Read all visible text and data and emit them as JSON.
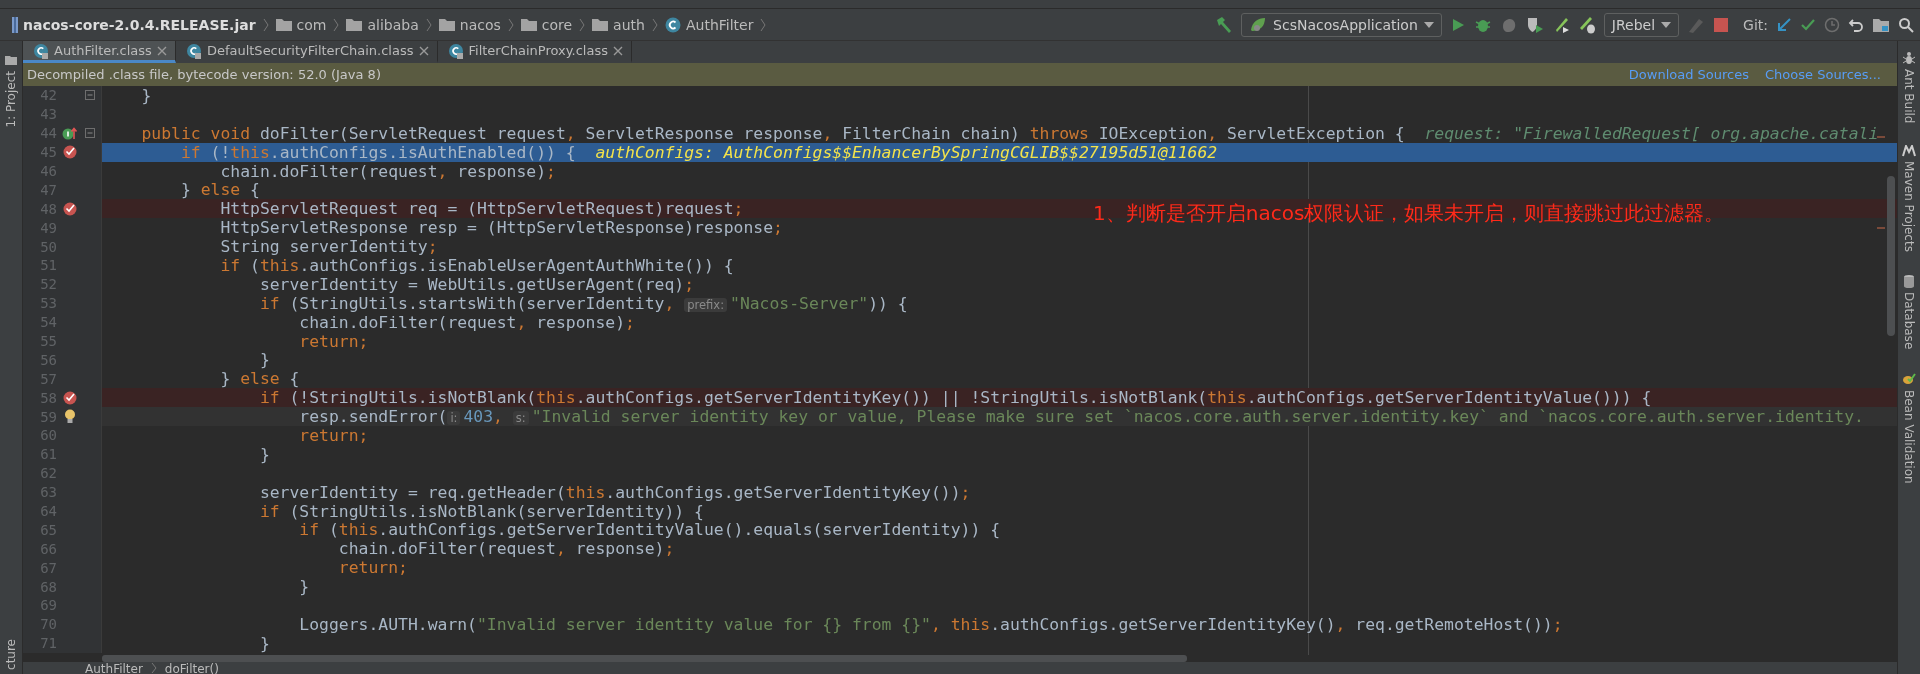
{
  "breadcrumbs": [
    {
      "kind": "jar",
      "label": "nacos-core-2.0.4.RELEASE.jar"
    },
    {
      "kind": "package",
      "label": "com"
    },
    {
      "kind": "package",
      "label": "alibaba"
    },
    {
      "kind": "package",
      "label": "nacos"
    },
    {
      "kind": "package",
      "label": "core"
    },
    {
      "kind": "package",
      "label": "auth"
    },
    {
      "kind": "class",
      "label": "AuthFilter"
    }
  ],
  "toolbar": {
    "run_config": "ScsNacosApplication",
    "jrebel": "JRebel",
    "git_label": "Git:"
  },
  "tabs": [
    {
      "label": "AuthFilter.class",
      "selected": true
    },
    {
      "label": "DefaultSecurityFilterChain.class",
      "selected": false
    },
    {
      "label": "FilterChainProxy.class",
      "selected": false
    }
  ],
  "left_tools": [
    {
      "label": "1: Project"
    }
  ],
  "left_tools_bottom": [
    {
      "label": "cture"
    }
  ],
  "right_tools": [
    {
      "kind": "ant",
      "label": "Ant Build"
    },
    {
      "kind": "maven",
      "label": "Maven Projects"
    },
    {
      "kind": "database",
      "label": "Database"
    },
    {
      "kind": "bean",
      "label": "Bean Validation"
    }
  ],
  "banner": {
    "text": "Decompiled .class file, bytecode version: 52.0 (Java 8)",
    "links": [
      "Download Sources",
      "Choose Sources..."
    ]
  },
  "annotation": "1、判断是否开启nacos权限认证，如果未开启，则直接跳过此过滤器。",
  "lines": [
    {
      "number": "42",
      "kind": "plain",
      "fold": true,
      "tokens": [
        {
          "kind": "plain",
          "t": "    }"
        }
      ]
    },
    {
      "number": "43",
      "kind": "plain",
      "fold": false
    },
    {
      "number": "44",
      "kind": "plain",
      "gutter_icon": {
        "kind": "override"
      },
      "fold": true,
      "tokens": [
        {
          "kind": "kw",
          "t": "    public void"
        },
        {
          "kind": "plain",
          "t": " doFilter(ServletRequest request"
        },
        {
          "kind": "kw",
          "t": ","
        },
        {
          "kind": "plain",
          "t": " ServletResponse response"
        },
        {
          "kind": "kw",
          "t": ","
        },
        {
          "kind": "plain",
          "t": " FilterChain chain) "
        },
        {
          "kind": "kw",
          "t": "throws"
        },
        {
          "kind": "plain",
          "t": " IOException"
        },
        {
          "kind": "kw",
          "t": ","
        },
        {
          "kind": "plain",
          "t": " ServletException {  "
        },
        {
          "kind": "debug",
          "t": "request: \"FirewalledRequest[ org.apache.catali"
        }
      ]
    },
    {
      "number": "45",
      "kind": "current",
      "gutter_icon": {
        "kind": "breakpoint"
      },
      "fold": false,
      "tokens": [
        {
          "kind": "kw",
          "t": "        if"
        },
        {
          "kind": "plain",
          "t": " (!"
        },
        {
          "kind": "kw",
          "t": "this"
        },
        {
          "kind": "plain",
          "t": ".authConfigs.isAuthEnabled()) {  "
        },
        {
          "kind": "debug",
          "t": "authConfigs: AuthConfigs$$EnhancerBySpringCGLIB$$27195d51@11662"
        }
      ]
    },
    {
      "number": "46",
      "kind": "plain",
      "fold": false,
      "tokens": [
        {
          "kind": "plain",
          "t": "            chain.doFilter(request"
        },
        {
          "kind": "kw",
          "t": ","
        },
        {
          "kind": "plain",
          "t": " response)"
        },
        {
          "kind": "kw",
          "t": ";"
        }
      ]
    },
    {
      "number": "47",
      "kind": "plain",
      "fold": false,
      "tokens": [
        {
          "kind": "plain",
          "t": "        } "
        },
        {
          "kind": "kw",
          "t": "else"
        },
        {
          "kind": "plain",
          "t": " {"
        }
      ]
    },
    {
      "number": "48",
      "kind": "breakpoint",
      "gutter_icon": {
        "kind": "breakpoint"
      },
      "fold": false,
      "tokens": [
        {
          "kind": "plain",
          "t": "            HttpServletRequest req = (HttpServletRequest)request"
        },
        {
          "kind": "kw",
          "t": ";"
        }
      ]
    },
    {
      "number": "49",
      "kind": "plain",
      "fold": false,
      "tokens": [
        {
          "kind": "plain",
          "t": "            HttpServletResponse resp = (HttpServletResponse)response"
        },
        {
          "kind": "kw",
          "t": ";"
        }
      ]
    },
    {
      "number": "50",
      "kind": "plain",
      "fold": false,
      "tokens": [
        {
          "kind": "plain",
          "t": "            String serverIdentity"
        },
        {
          "kind": "kw",
          "t": ";"
        }
      ]
    },
    {
      "number": "51",
      "kind": "plain",
      "fold": false,
      "tokens": [
        {
          "kind": "kw",
          "t": "            if"
        },
        {
          "kind": "plain",
          "t": " ("
        },
        {
          "kind": "kw",
          "t": "this"
        },
        {
          "kind": "plain",
          "t": ".authConfigs.isEnableUserAgentAuthWhite()) {"
        }
      ]
    },
    {
      "number": "52",
      "kind": "plain",
      "fold": false,
      "tokens": [
        {
          "kind": "plain",
          "t": "                serverIdentity = WebUtils.getUserAgent(req)"
        },
        {
          "kind": "kw",
          "t": ";"
        }
      ]
    },
    {
      "number": "53",
      "kind": "plain",
      "fold": false,
      "tokens": [
        {
          "kind": "kw",
          "t": "                if"
        },
        {
          "kind": "plain",
          "t": " (StringUtils.startsWith(serverIdentity"
        },
        {
          "kind": "kw",
          "t": ", "
        },
        {
          "kind": "hint",
          "t": "prefix:"
        },
        {
          "kind": "str",
          "t": "\"Nacos-Server\""
        },
        {
          "kind": "plain",
          "t": ")) {"
        }
      ]
    },
    {
      "number": "54",
      "kind": "plain",
      "fold": false,
      "tokens": [
        {
          "kind": "plain",
          "t": "                    chain.doFilter(request"
        },
        {
          "kind": "kw",
          "t": ","
        },
        {
          "kind": "plain",
          "t": " response)"
        },
        {
          "kind": "kw",
          "t": ";"
        }
      ]
    },
    {
      "number": "55",
      "kind": "plain",
      "fold": false,
      "tokens": [
        {
          "kind": "kw",
          "t": "                    return;"
        }
      ]
    },
    {
      "number": "56",
      "kind": "plain",
      "fold": false,
      "tokens": [
        {
          "kind": "plain",
          "t": "                }"
        }
      ]
    },
    {
      "number": "57",
      "kind": "plain",
      "fold": false,
      "tokens": [
        {
          "kind": "plain",
          "t": "            } "
        },
        {
          "kind": "kw",
          "t": "else"
        },
        {
          "kind": "plain",
          "t": " {"
        }
      ]
    },
    {
      "number": "58",
      "kind": "breakpoint",
      "gutter_icon": {
        "kind": "breakpoint"
      },
      "fold": false,
      "tokens": [
        {
          "kind": "kw",
          "t": "                if"
        },
        {
          "kind": "plain",
          "t": " (!StringUtils.isNotBlank("
        },
        {
          "kind": "kw",
          "t": "this"
        },
        {
          "kind": "plain",
          "t": ".authConfigs.getServerIdentityKey()) || !StringUtils.isNotBlank("
        },
        {
          "kind": "kw",
          "t": "this"
        },
        {
          "kind": "plain",
          "t": ".authConfigs.getServerIdentityValue())) {"
        }
      ]
    },
    {
      "number": "59",
      "kind": "caret",
      "gutter_icon": {
        "kind": "bulb"
      },
      "fold": false,
      "tokens": [
        {
          "kind": "plain",
          "t": "                    resp.sendError("
        },
        {
          "kind": "hint",
          "t": "i:"
        },
        {
          "kind": "num",
          "t": "403"
        },
        {
          "kind": "kw",
          "t": ", "
        },
        {
          "kind": "hint",
          "t": "s:"
        },
        {
          "kind": "str",
          "t": "\"Invalid server identity key or value, Please make sure set `nacos.core.auth.server.identity.key` and `nacos.core.auth.server.identity."
        }
      ]
    },
    {
      "number": "60",
      "kind": "plain",
      "fold": false,
      "tokens": [
        {
          "kind": "kw",
          "t": "                    return;"
        }
      ]
    },
    {
      "number": "61",
      "kind": "plain",
      "fold": false,
      "tokens": [
        {
          "kind": "plain",
          "t": "                }"
        }
      ]
    },
    {
      "number": "62",
      "kind": "plain",
      "fold": false
    },
    {
      "number": "63",
      "kind": "plain",
      "fold": false,
      "tokens": [
        {
          "kind": "plain",
          "t": "                serverIdentity = req.getHeader("
        },
        {
          "kind": "kw",
          "t": "this"
        },
        {
          "kind": "plain",
          "t": ".authConfigs.getServerIdentityKey())"
        },
        {
          "kind": "kw",
          "t": ";"
        }
      ]
    },
    {
      "number": "64",
      "kind": "plain",
      "fold": false,
      "tokens": [
        {
          "kind": "kw",
          "t": "                if"
        },
        {
          "kind": "plain",
          "t": " (StringUtils.isNotBlank(serverIdentity)) {"
        }
      ]
    },
    {
      "number": "65",
      "kind": "plain",
      "fold": false,
      "tokens": [
        {
          "kind": "kw",
          "t": "                    if"
        },
        {
          "kind": "plain",
          "t": " ("
        },
        {
          "kind": "kw",
          "t": "this"
        },
        {
          "kind": "plain",
          "t": ".authConfigs.getServerIdentityValue().equals(serverIdentity)) {"
        }
      ]
    },
    {
      "number": "66",
      "kind": "plain",
      "fold": false,
      "tokens": [
        {
          "kind": "plain",
          "t": "                        chain.doFilter(request"
        },
        {
          "kind": "kw",
          "t": ","
        },
        {
          "kind": "plain",
          "t": " response)"
        },
        {
          "kind": "kw",
          "t": ";"
        }
      ]
    },
    {
      "number": "67",
      "kind": "plain",
      "fold": false,
      "tokens": [
        {
          "kind": "kw",
          "t": "                        return;"
        }
      ]
    },
    {
      "number": "68",
      "kind": "plain",
      "fold": false,
      "tokens": [
        {
          "kind": "plain",
          "t": "                    }"
        }
      ]
    },
    {
      "number": "69",
      "kind": "plain",
      "fold": false
    },
    {
      "number": "70",
      "kind": "plain",
      "fold": false,
      "tokens": [
        {
          "kind": "plain",
          "t": "                    Loggers.AUTH.warn("
        },
        {
          "kind": "str",
          "t": "\"Invalid server identity value for {} from {}\""
        },
        {
          "kind": "kw",
          "t": ", this"
        },
        {
          "kind": "plain",
          "t": ".authConfigs.getServerIdentityKey()"
        },
        {
          "kind": "kw",
          "t": ","
        },
        {
          "kind": "plain",
          "t": " req.getRemoteHost())"
        },
        {
          "kind": "kw",
          "t": ";"
        }
      ]
    },
    {
      "number": "71",
      "kind": "plain",
      "fold": false,
      "tokens": [
        {
          "kind": "plain",
          "t": "                }"
        }
      ]
    }
  ],
  "footer_breadcrumbs": [
    "AuthFilter",
    "doFilter()"
  ]
}
